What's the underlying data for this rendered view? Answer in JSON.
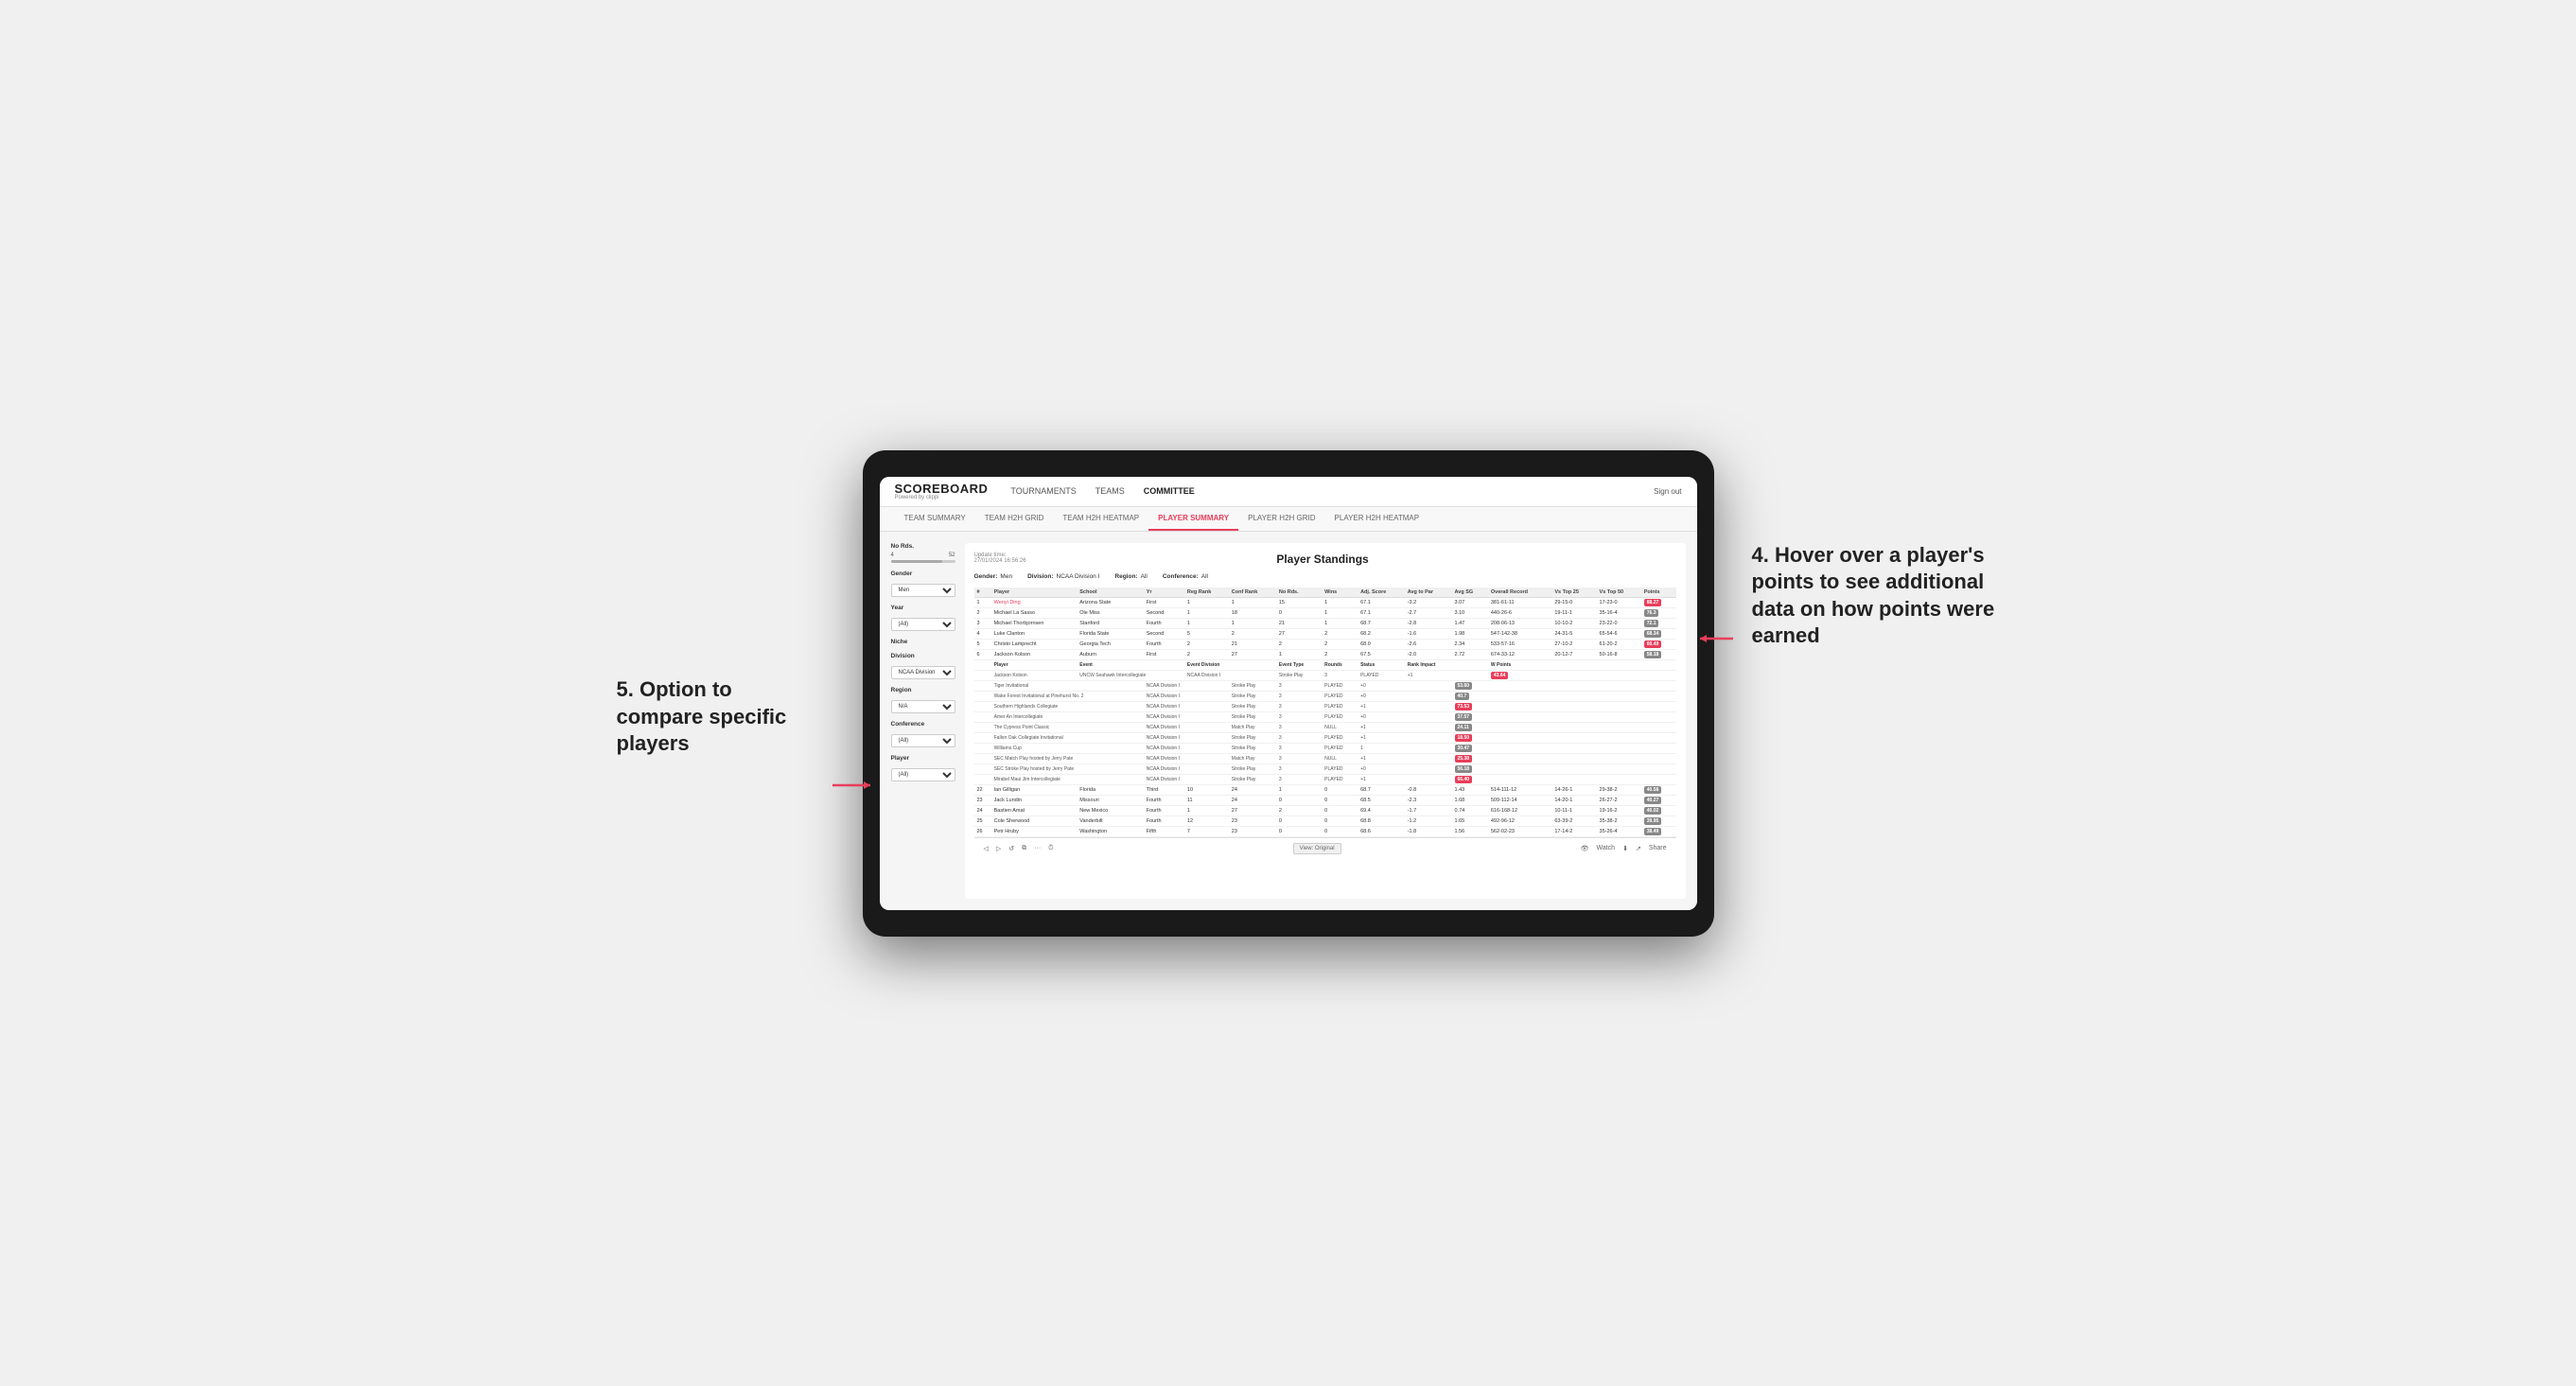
{
  "app": {
    "logo": "SCOREBOARD",
    "logo_sub": "Powered by clippi",
    "sign_in": "Sign out",
    "nav": [
      "TOURNAMENTS",
      "TEAMS",
      "COMMITTEE"
    ],
    "sub_nav": [
      {
        "label": "TEAM SUMMARY",
        "active": false
      },
      {
        "label": "TEAM H2H GRID",
        "active": false
      },
      {
        "label": "TEAM H2H HEATMAP",
        "active": false
      },
      {
        "label": "PLAYER SUMMARY",
        "active": true
      },
      {
        "label": "PLAYER H2H GRID",
        "active": false
      },
      {
        "label": "PLAYER H2H HEATMAP",
        "active": false
      }
    ]
  },
  "sidebar": {
    "no_rds_label": "No Rds.",
    "range_min": "4",
    "range_max": "52",
    "gender_label": "Gender",
    "gender_value": "Men",
    "year_label": "Year",
    "year_value": "(All)",
    "niche_label": "Niche",
    "division_label": "Division",
    "division_value": "NCAA Division I",
    "region_label": "Region",
    "region_value": "N/A",
    "conference_label": "Conference",
    "conference_value": "(All)",
    "player_label": "Player",
    "player_value": "(All)"
  },
  "panel": {
    "title": "Player Standings",
    "update_time": "Update time:",
    "update_date": "27/01/2024 16:56:26",
    "filters": {
      "gender_label": "Gender:",
      "gender_value": "Men",
      "division_label": "Division:",
      "division_value": "NCAA Division I",
      "region_label": "Region:",
      "region_value": "All",
      "conference_label": "Conference:",
      "conference_value": "All"
    },
    "table_headers": [
      "#",
      "Player",
      "School",
      "Yr",
      "Reg Rank",
      "Conf Rank",
      "No Rds.",
      "Wins",
      "Adj. Score",
      "Avg to Par",
      "Avg SG",
      "Overall Record",
      "Vs Top 25",
      "Vs Top 50",
      "Points"
    ],
    "players": [
      {
        "num": "1",
        "name": "Wenyi Ding",
        "school": "Arizona State",
        "yr": "First",
        "reg_rank": "1",
        "conf_rank": "1",
        "no_rds": "15",
        "wins": "1",
        "adj_score": "67.1",
        "to_par": "-3.2",
        "avg_sg": "3.07",
        "overall": "381-61-11",
        "vs_top25": "29-15-0",
        "vs_top50": "17-23-0",
        "points": "88.27",
        "points_highlight": true
      },
      {
        "num": "2",
        "name": "Michael La Sasso",
        "school": "Ole Miss",
        "yr": "Second",
        "reg_rank": "1",
        "conf_rank": "18",
        "no_rds": "0",
        "wins": "1",
        "adj_score": "67.1",
        "to_par": "-2.7",
        "avg_sg": "3.10",
        "overall": "440-26-6",
        "vs_top25": "19-11-1",
        "vs_top50": "35-16-4",
        "points": "76.3",
        "points_highlight": false
      },
      {
        "num": "3",
        "name": "Michael Thorbjornsen",
        "school": "Stanford",
        "yr": "Fourth",
        "reg_rank": "1",
        "conf_rank": "1",
        "no_rds": "21",
        "wins": "1",
        "adj_score": "68.7",
        "to_par": "-2.8",
        "avg_sg": "1.47",
        "overall": "208-06-13",
        "vs_top25": "10-10-2",
        "vs_top50": "23-22-0",
        "points": "72.1",
        "points_highlight": false
      },
      {
        "num": "4",
        "name": "Luke Clanton",
        "school": "Florida State",
        "yr": "Second",
        "reg_rank": "5",
        "conf_rank": "2",
        "no_rds": "27",
        "wins": "2",
        "adj_score": "68.2",
        "to_par": "-1.6",
        "avg_sg": "1.98",
        "overall": "547-142-38",
        "vs_top25": "24-31-5",
        "vs_top50": "65-54-6",
        "points": "68.34",
        "points_highlight": false
      },
      {
        "num": "5",
        "name": "Christo Lamprecht",
        "school": "Georgia Tech",
        "yr": "Fourth",
        "reg_rank": "2",
        "conf_rank": "21",
        "no_rds": "2",
        "wins": "2",
        "adj_score": "68.0",
        "to_par": "-2.6",
        "avg_sg": "2.34",
        "overall": "533-57-16",
        "vs_top25": "27-10-2",
        "vs_top50": "61-20-2",
        "points": "60.49",
        "points_highlight": false
      },
      {
        "num": "6",
        "name": "Jackson Kolson",
        "school": "Auburn",
        "yr": "First",
        "reg_rank": "2",
        "conf_rank": "27",
        "no_rds": "1",
        "wins": "2",
        "adj_score": "67.5",
        "to_par": "-2.0",
        "avg_sg": "2.72",
        "overall": "674-33-12",
        "vs_top25": "20-12-7",
        "vs_top50": "50-16-8",
        "points": "58.18",
        "points_highlight": false
      }
    ],
    "event_subrows_header": [
      "Player",
      "Event",
      "Event Division",
      "Event Type",
      "Rounds",
      "Status",
      "Rank Impact",
      "W Points"
    ],
    "event_subrows": [
      {
        "player": "Jackson Kolson",
        "event": "UNCW Seahawk Intercollegiate",
        "division": "NCAA Division I",
        "type": "Stroke Play",
        "rounds": "3",
        "status": "PLAYED",
        "rank": "+1",
        "points": "43.64",
        "highlight": true
      },
      {
        "player": "",
        "event": "Tiger Invitational",
        "division": "NCAA Division I",
        "type": "Stroke Play",
        "rounds": "3",
        "status": "PLAYED",
        "rank": "+0",
        "points": "53.60"
      },
      {
        "player": "",
        "event": "Wake Forest Invitational at Pinehurst No. 2",
        "division": "NCAA Division I",
        "type": "Stroke Play",
        "rounds": "3",
        "status": "PLAYED",
        "rank": "+0",
        "points": "40.7"
      },
      {
        "player": "",
        "event": "Southern Highlands Collegiate",
        "division": "NCAA Division I",
        "type": "Stroke Play",
        "rounds": "3",
        "status": "PLAYED",
        "rank": "+1",
        "points": "73.53",
        "highlight": true
      },
      {
        "player": "",
        "event": "Amer An Intercollegiate",
        "division": "NCAA Division I",
        "type": "Stroke Play",
        "rounds": "3",
        "status": "PLAYED",
        "rank": "+0",
        "points": "37.57"
      },
      {
        "player": "",
        "event": "The Cypress Point Classic",
        "division": "NCAA Division I",
        "type": "Match Play",
        "rounds": "3",
        "status": "NULL",
        "rank": "+1",
        "points": "24.11"
      },
      {
        "player": "",
        "event": "Fallon Oak Collegiate Invitational",
        "division": "NCAA Division I",
        "type": "Stroke Play",
        "rounds": "3",
        "status": "PLAYED",
        "rank": "+1",
        "points": "18.50",
        "highlight": true
      },
      {
        "player": "",
        "event": "Williams Cup",
        "division": "NCAA Division I",
        "type": "Stroke Play",
        "rounds": "3",
        "status": "PLAYED",
        "rank": "1",
        "points": "30.47"
      },
      {
        "player": "",
        "event": "SEC Match Play hosted by Jerry Pate",
        "division": "NCAA Division I",
        "type": "Match Play",
        "rounds": "3",
        "status": "NULL",
        "rank": "+1",
        "points": "25.38",
        "highlight": true
      },
      {
        "player": "",
        "event": "SEC Stroke Play hosted by Jerry Pate",
        "division": "NCAA Division I",
        "type": "Stroke Play",
        "rounds": "3",
        "status": "PLAYED",
        "rank": "+0",
        "points": "56.18"
      },
      {
        "player": "",
        "event": "Mirabel Maui Jim Intercollegiate",
        "division": "NCAA Division I",
        "type": "Stroke Play",
        "rounds": "3",
        "status": "PLAYED",
        "rank": "+1",
        "points": "66.40",
        "highlight": true
      }
    ],
    "lower_players": [
      {
        "num": "22",
        "name": "Ian Gilligan",
        "school": "Florida",
        "yr": "Third",
        "reg_rank": "10",
        "conf_rank": "24",
        "no_rds": "1",
        "wins": "0",
        "adj_score": "68.7",
        "to_par": "-0.8",
        "avg_sg": "1.43",
        "overall": "514-111-12",
        "vs_top25": "14-26-1",
        "vs_top50": "29-38-2",
        "points": "40.58"
      },
      {
        "num": "23",
        "name": "Jack Lundin",
        "school": "Missouri",
        "yr": "Fourth",
        "reg_rank": "11",
        "conf_rank": "24",
        "no_rds": "0",
        "wins": "0",
        "adj_score": "68.5",
        "to_par": "-2.3",
        "avg_sg": "1.68",
        "overall": "509-112-14",
        "vs_top25": "14-20-1",
        "vs_top50": "26-27-2",
        "points": "40.27"
      },
      {
        "num": "24",
        "name": "Bastien Amat",
        "school": "New Mexico",
        "yr": "Fourth",
        "reg_rank": "1",
        "conf_rank": "27",
        "no_rds": "2",
        "wins": "0",
        "adj_score": "69.4",
        "to_par": "-1.7",
        "avg_sg": "0.74",
        "overall": "616-168-12",
        "vs_top25": "10-11-1",
        "vs_top50": "19-16-2",
        "points": "40.02"
      },
      {
        "num": "25",
        "name": "Cole Sherwood",
        "school": "Vanderbilt",
        "yr": "Fourth",
        "reg_rank": "12",
        "conf_rank": "23",
        "no_rds": "0",
        "wins": "0",
        "adj_score": "68.8",
        "to_par": "-1.2",
        "avg_sg": "1.65",
        "overall": "492-96-12",
        "vs_top25": "63-39-2",
        "vs_top50": "35-38-2",
        "points": "39.95"
      },
      {
        "num": "26",
        "name": "Petr Hruby",
        "school": "Washington",
        "yr": "Fifth",
        "reg_rank": "7",
        "conf_rank": "23",
        "no_rds": "0",
        "wins": "0",
        "adj_score": "68.6",
        "to_par": "-1.8",
        "avg_sg": "1.56",
        "overall": "562-02-23",
        "vs_top25": "17-14-2",
        "vs_top50": "35-26-4",
        "points": "38.49"
      }
    ],
    "toolbar": {
      "view_original": "View: Original",
      "watch": "Watch",
      "share": "Share"
    }
  },
  "annotations": {
    "left": "5. Option to compare specific players",
    "right": "4. Hover over a player's points to see additional data on how points were earned"
  }
}
